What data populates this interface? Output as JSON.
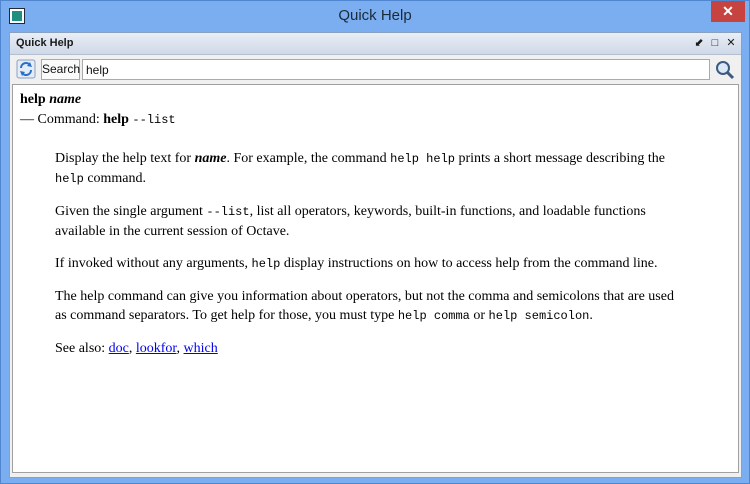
{
  "window": {
    "title": "Quick Help",
    "close_label": "✕"
  },
  "dock": {
    "title": "Quick Help",
    "float_glyph": "⬋",
    "maximize_glyph": "□",
    "close_glyph": "✕"
  },
  "toolbar": {
    "search_label": "Search",
    "search_value": "help"
  },
  "icons": {
    "refresh": "refresh-icon",
    "search": "search-icon"
  },
  "colors": {
    "accent": "#7aaef0",
    "close": "#c7433f",
    "link": "#0000ee"
  },
  "doc": {
    "heading_word": "help",
    "heading_arg": "name",
    "cmd_prefix": "— Command: ",
    "cmd_name": "help",
    "cmd_arg": "--list",
    "p1_a": "Display the help text for ",
    "p1_name": "name",
    "p1_b": ". For example, the command ",
    "p1_code1": "help help",
    "p1_c": " prints a short message describing the ",
    "p1_code2": "help",
    "p1_d": " command.",
    "p2_a": "Given the single argument ",
    "p2_code": "--list",
    "p2_b": ", list all operators, keywords, built-in functions, and loadable functions available in the current session of Octave.",
    "p3_a": "If invoked without any arguments, ",
    "p3_code": "help",
    "p3_b": " display instructions on how to access help from the command line.",
    "p4_a": "The help command can give you information about operators, but not the comma and semicolons that are used as command separators. To get help for those, you must type ",
    "p4_code1": "help comma",
    "p4_b": " or ",
    "p4_code2": "help semicolon",
    "p4_c": ".",
    "see_also_label": "See also: ",
    "see_also": [
      "doc",
      "lookfor",
      "which"
    ],
    "sep": ", "
  }
}
